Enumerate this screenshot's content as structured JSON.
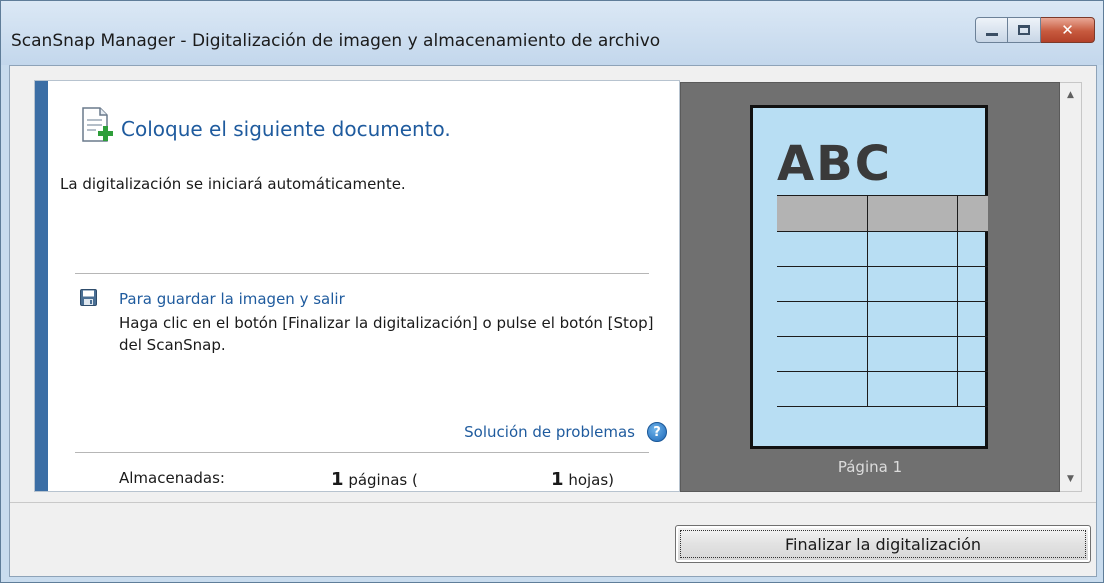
{
  "window": {
    "title": "ScanSnap Manager - Digitalización de imagen y almacenamiento de archivo"
  },
  "message": {
    "heading": "Coloque el siguiente documento.",
    "subtext": "La digitalización se iniciará automáticamente."
  },
  "save_section": {
    "title": "Para guardar la imagen y salir",
    "description": "Haga clic en el botón [Finalizar la digitalización] o pulse el botón [Stop] del ScanSnap."
  },
  "troubleshooting_link": "Solución de problemas",
  "counts": {
    "label": "Almacenadas:",
    "pages_value": "1",
    "pages_unit": "páginas (",
    "sheets_value": "1",
    "sheets_unit": "hojas)"
  },
  "preview": {
    "thumbnail_text": "ABC",
    "page_caption": "Página 1"
  },
  "buttons": {
    "finish": "Finalizar la digitalización"
  },
  "colors": {
    "accent": "#3b6ea5",
    "link": "#1f5b9e",
    "thumbnail_bg": "#b8def3",
    "close_button": "#c75a3e"
  },
  "icons": {
    "document": "document-add-icon",
    "save": "save-disk-icon",
    "help": "help-icon"
  }
}
